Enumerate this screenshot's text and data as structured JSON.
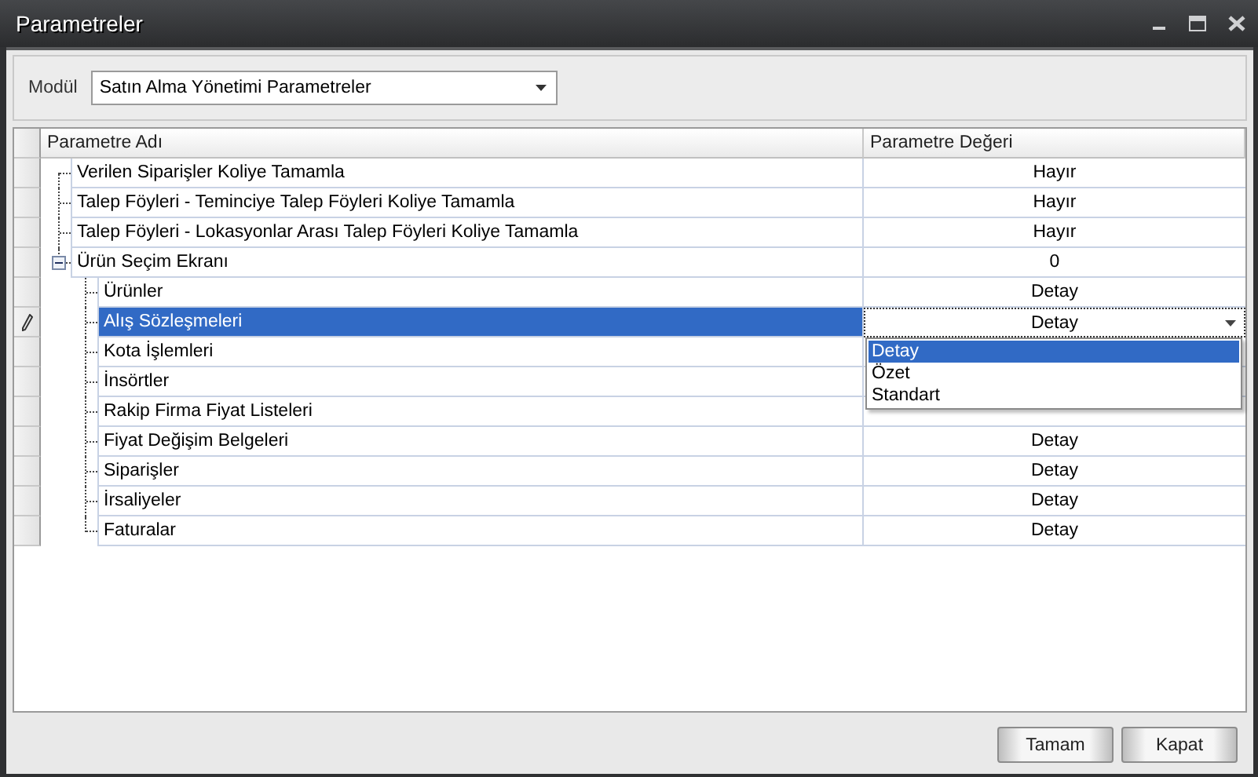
{
  "window": {
    "title": "Parametreler"
  },
  "module": {
    "label": "Modül",
    "value": "Satın Alma Yönetimi Parametreler"
  },
  "grid": {
    "columns": [
      "Parametre Adı",
      "Parametre Değeri"
    ],
    "rows": [
      {
        "name": "Verilen Siparişler Koliye Tamamla",
        "value": "Hayır",
        "selected": false
      },
      {
        "name": "Talep Föyleri - Teminciye Talep Föyleri Koliye Tamamla",
        "value": "Hayır",
        "selected": false
      },
      {
        "name": "Talep Föyleri - Lokasyonlar Arası Talep Föyleri Koliye Tamamla",
        "value": "Hayır",
        "selected": false
      },
      {
        "name": "Ürün Seçim Ekranı",
        "value": "0",
        "selected": false,
        "expanded": true,
        "children": [
          {
            "name": "Ürünler",
            "value": "Detay",
            "selected": false
          },
          {
            "name": "Alış Sözleşmeleri",
            "selected": true,
            "editor": {
              "value": "Detay",
              "options": [
                {
                  "label": "Detay",
                  "selected": true
                },
                {
                  "label": "Özet",
                  "selected": false
                },
                {
                  "label": "Standart",
                  "selected": false
                }
              ]
            }
          },
          {
            "name": "Kota İşlemleri",
            "selected": false
          },
          {
            "name": "İnsörtler",
            "selected": false
          },
          {
            "name": "Rakip Firma Fiyat Listeleri",
            "selected": false
          },
          {
            "name": "Fiyat Değişim Belgeleri",
            "value": "Detay",
            "selected": false
          },
          {
            "name": "Siparişler",
            "value": "Detay",
            "selected": false
          },
          {
            "name": "İrsaliyeler",
            "value": "Detay",
            "selected": false
          },
          {
            "name": "Faturalar",
            "value": "Detay",
            "selected": false
          }
        ]
      }
    ]
  },
  "buttons": [
    "Tamam",
    "Kapat"
  ]
}
